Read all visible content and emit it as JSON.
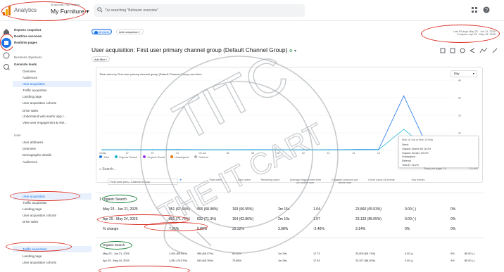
{
  "app": {
    "name": "Analytics",
    "account_path": "All accounts > My Furniture",
    "property": "My Furniture"
  },
  "search": {
    "placeholder": "Try searching \"Behavior overview\""
  },
  "sidebar": {
    "items": [
      {
        "label": "Reports snapshot",
        "bold": true
      },
      {
        "label": "Realtime overview",
        "bold": true
      },
      {
        "label": "Realtime pages",
        "bold": true
      },
      {
        "label": "Business objectives",
        "section": true
      },
      {
        "label": "Generate leads",
        "bold": true
      },
      {
        "label": "Overview"
      },
      {
        "label": "Audiences"
      },
      {
        "label": "User acquisition",
        "selected": true
      },
      {
        "label": "Traffic acquisition"
      },
      {
        "label": "Landing page"
      },
      {
        "label": "User acquisition cohorts"
      },
      {
        "label": "Drive sales"
      },
      {
        "label": "Understand web and/or app t..."
      },
      {
        "label": "View user engagement & rete..."
      },
      {
        "label": "User",
        "section": true
      },
      {
        "label": "User attributes"
      },
      {
        "label": "Overview"
      },
      {
        "label": "Demographic details"
      },
      {
        "label": "Audiences"
      },
      {
        "label": "User acquisition",
        "selected": true
      },
      {
        "label": "Traffic acquisition"
      },
      {
        "label": "Landing page"
      },
      {
        "label": "User acquisition cohorts"
      },
      {
        "label": "Drive sales"
      },
      {
        "label": "Traffic acquisition",
        "selected": true
      },
      {
        "label": "Landing page"
      },
      {
        "label": "User acquisition cohorts"
      }
    ]
  },
  "toolbar": {
    "all_users": "All Users",
    "add_comparison": "Add comparison +",
    "add_filter": "Add filter +"
  },
  "date_range": {
    "current": "Last 90 days May 23 - Jun 21, 2025",
    "compare": "Compare: Apr 25 - May 24, 2025"
  },
  "page_title": "User acquisition: First user primary channel group (Default Channel Group)",
  "chart": {
    "title": "Total users by First user primary channel group (Default Channel Group) over time",
    "granularity": "Day",
    "y_ticks": [
      "0",
      "1k",
      "2k",
      "3k",
      "4k"
    ],
    "x_ticks": [
      "25 May",
      "27",
      "29",
      "31",
      "02 Jun",
      "04",
      "06",
      "08",
      "10",
      "12",
      "14",
      "16",
      "18",
      "20",
      "21"
    ],
    "legend": [
      "Total",
      "Organic Search",
      "Organic Social",
      "Unassigned",
      "Referral"
    ],
    "colors": {
      "total": "#1a73e8",
      "organic_search": "#12b5cb",
      "organic_social": "#9334e6",
      "unassigned": "#e8710a"
    }
  },
  "chart_data": {
    "type": "line",
    "x": [
      "May 25",
      "May 27",
      "May 29",
      "May 31",
      "Jun 02",
      "Jun 04",
      "Jun 06",
      "Jun 08",
      "Jun 10",
      "Jun 12",
      "Jun 14",
      "Jun 16",
      "Jun 18",
      "Jun 20",
      "Jun 21"
    ],
    "series": [
      {
        "name": "Total",
        "values": [
          40,
          40,
          45,
          50,
          40,
          40,
          45,
          40,
          40,
          40,
          50,
          60,
          3100,
          40,
          40
        ]
      },
      {
        "name": "Organic Search",
        "values": [
          30,
          30,
          32,
          35,
          30,
          30,
          33,
          30,
          30,
          30,
          35,
          40,
          1200,
          30,
          30
        ]
      }
    ],
    "ylim": [
      0,
      4000
    ]
  },
  "tooltip": {
    "header": "Mon 16 Jun vs Mon 19 May",
    "rows": [
      "Direct",
      "Organic Search 65  18.3%",
      "Organic Social 1  50.0%",
      "Unassigned",
      "Referral",
      "Total 67  16.2%"
    ]
  },
  "table": {
    "search_placeholder": "Search...",
    "rows_per_page": "Rows per page: 10",
    "pagination": "1-5 of 5",
    "dimension": "First user prim...Channel Group",
    "headers": [
      "Total users",
      "New users",
      "Returning users",
      "Average engagement time per active user",
      "Engaged sessions per active user",
      "Event count All events",
      "Key events"
    ],
    "group1": {
      "label": "1   Organic Search",
      "row1": {
        "label": "May 23 - Jun 21, 2025",
        "values": [
          "951 (67.64%)",
          "906 (68.98%)",
          "193 (66.55%)",
          "2m 15s",
          "1.04",
          "23,860 (65.53%)",
          "0.00 (-)",
          "0%"
        ]
      },
      "row2": {
        "label": "Apr 25 - May 24, 2025",
        "values": [
          "881 (71.76%)",
          "832 (71.3%)",
          "154 (62.86%)",
          "2m 10s",
          "1.07",
          "23,133 (85.05%)",
          "0.00 (-)",
          "0%"
        ]
      },
      "change": {
        "label": "% change",
        "values": [
          "7.95%",
          "8.89%",
          "25.32%",
          "3.98%",
          "-2.46%",
          "3.14%",
          "0%",
          "0%"
        ]
      }
    },
    "group2": {
      "label": "Organic Search",
      "row1": {
        "label": "May 23 - Jun 21, 2025",
        "values": [
          "1,404 (65.98%)",
          "996 (68.27%)",
          "60.46%",
          "1m 33s",
          "17.73",
          "25,903 (65.71%)",
          "0.00 (-)",
          "0%",
          "$0.00 (-)"
        ]
      },
      "row2": {
        "label": "Apr 25 - May 24, 2025",
        "values": [
          "1,281 (76.57%)",
          "940 (65.76%)",
          "70.86%",
          "1m 26s",
          "17.53",
          "23,327 (86.30%)",
          "0.00 (-)",
          "0%",
          "$0.00 (-)"
        ]
      }
    }
  },
  "watermark": {
    "top": "TITC",
    "bottom": "THE IT CART"
  }
}
